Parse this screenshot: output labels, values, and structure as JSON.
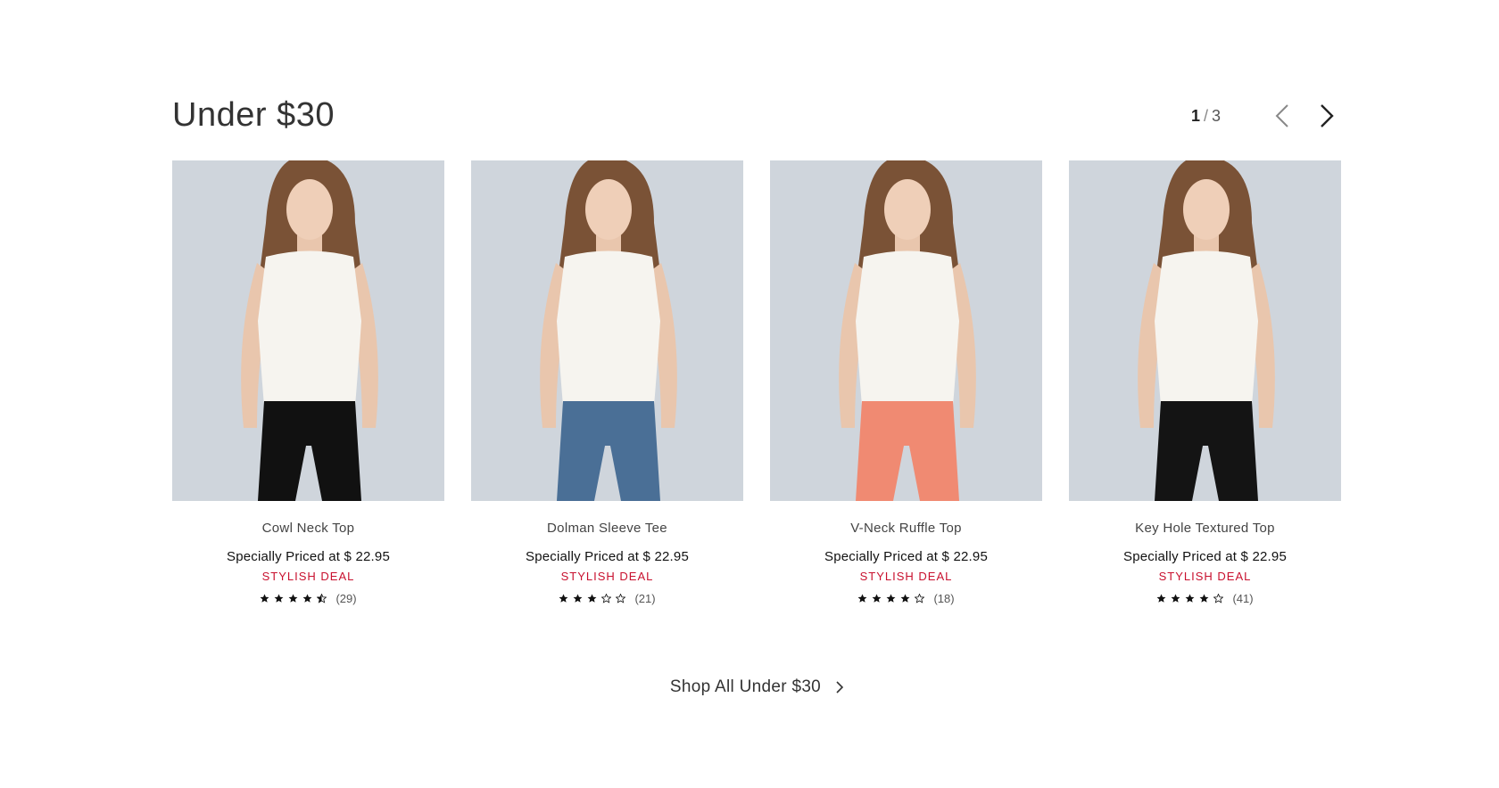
{
  "section": {
    "title": "Under $30",
    "page_current": "1",
    "page_separator": "/",
    "page_total": "3"
  },
  "products": [
    {
      "name": "Cowl Neck Top",
      "price": "Specially Priced at $ 22.95",
      "badge": "STYLISH DEAL",
      "rating": 4.5,
      "review_count": "(29)",
      "pants_color": "#111111",
      "pants_label": "black pants"
    },
    {
      "name": "Dolman Sleeve Tee",
      "price": "Specially Priced at $ 22.95",
      "badge": "STYLISH DEAL",
      "rating": 3,
      "review_count": "(21)",
      "pants_color": "#4a6f96",
      "pants_label": "blue jeans"
    },
    {
      "name": "V-Neck Ruffle Top",
      "price": "Specially Priced at $ 22.95",
      "badge": "STYLISH DEAL",
      "rating": 4,
      "review_count": "(18)",
      "pants_color": "#f08a72",
      "pants_label": "coral pants"
    },
    {
      "name": "Key Hole Textured Top",
      "price": "Specially Priced at $ 22.95",
      "badge": "STYLISH DEAL",
      "rating": 4,
      "review_count": "(41)",
      "pants_color": "#141414",
      "pants_label": "black pants"
    }
  ],
  "shop_all": {
    "label": "Shop All Under $30"
  },
  "colors": {
    "deal_red": "#c8102e",
    "photo_bg": "#cfd5dc"
  },
  "icons": {
    "prev": "chevron-left-icon",
    "next": "chevron-right-icon",
    "shop_all": "chevron-right-icon",
    "star_full": "star-full-icon",
    "star_half": "star-half-icon",
    "star_empty": "star-empty-icon"
  }
}
